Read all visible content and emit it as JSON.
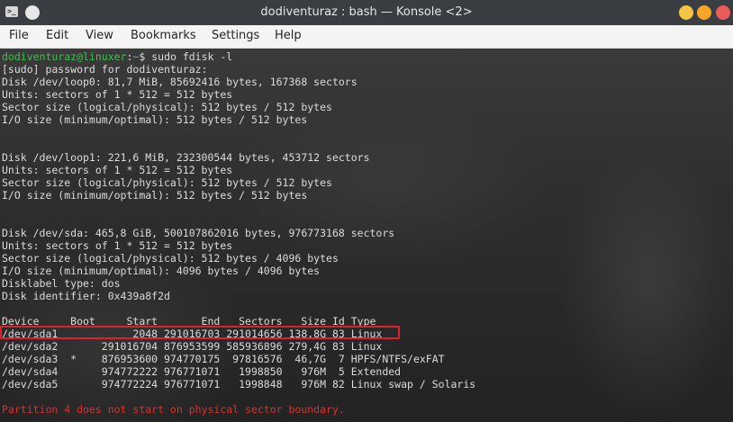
{
  "window": {
    "title": "dodiventuraz : bash — Konsole <2>",
    "app_icon": ">_"
  },
  "menu": {
    "items": [
      "File",
      "Edit",
      "View",
      "Bookmarks",
      "Settings",
      "Help"
    ]
  },
  "terminal": {
    "prompt_user": "dodiventuraz@linuxer",
    "prompt_sep": ":",
    "prompt_path": "~",
    "prompt_symbol": "$",
    "command": " sudo fdisk -l",
    "lines": [
      "[sudo] password for dodiventuraz:",
      "Disk /dev/loop0: 81,7 MiB, 85692416 bytes, 167368 sectors",
      "Units: sectors of 1 * 512 = 512 bytes",
      "Sector size (logical/physical): 512 bytes / 512 bytes",
      "I/O size (minimum/optimal): 512 bytes / 512 bytes",
      "",
      "",
      "Disk /dev/loop1: 221,6 MiB, 232300544 bytes, 453712 sectors",
      "Units: sectors of 1 * 512 = 512 bytes",
      "Sector size (logical/physical): 512 bytes / 512 bytes",
      "I/O size (minimum/optimal): 512 bytes / 512 bytes",
      "",
      "",
      "Disk /dev/sda: 465,8 GiB, 500107862016 bytes, 976773168 sectors",
      "Units: sectors of 1 * 512 = 512 bytes",
      "Sector size (logical/physical): 512 bytes / 4096 bytes",
      "I/O size (minimum/optimal): 4096 bytes / 4096 bytes",
      "Disklabel type: dos",
      "Disk identifier: 0x439a8f2d",
      ""
    ],
    "partition_header": "Device     Boot     Start       End   Sectors   Size Id Type",
    "partitions": [
      "/dev/sda1            2048 291016703 291014656 138,8G 83 Linux",
      "/dev/sda2       291016704 876953599 585936896 279,4G 83 Linux",
      "/dev/sda3  *    876953600 974770175  97816576  46,7G  7 HPFS/NTFS/exFAT",
      "/dev/sda4       974772222 976771071   1998850   976M  5 Extended",
      "/dev/sda5       974772224 976771071   1998848   976M 82 Linux swap / Solaris"
    ],
    "blank_after": "",
    "warning": "Partition 4 does not start on physical sector boundary.",
    "highlighted_partition": "/dev/sda1"
  },
  "colors": {
    "prompt_user": "#3cc24b",
    "prompt_path": "#6aa2f0",
    "warning": "#d9322e",
    "highlight_box": "#e0202a"
  }
}
